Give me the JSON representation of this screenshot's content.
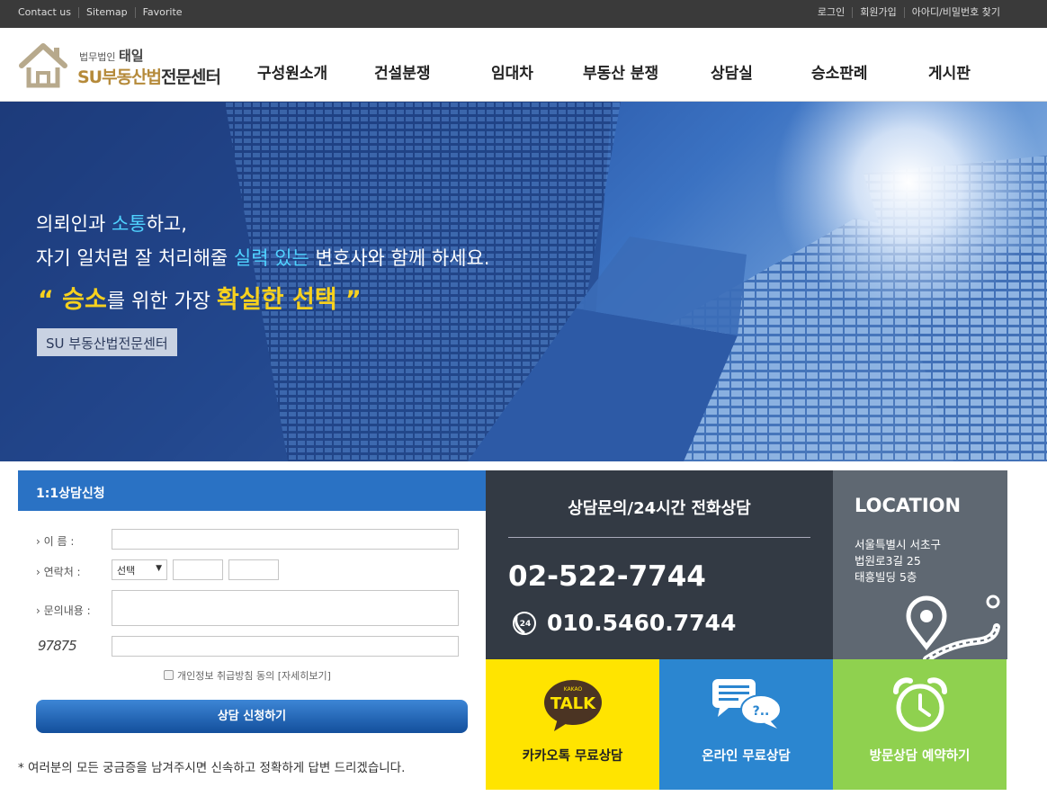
{
  "topbar": {
    "left_links": [
      "Contact us",
      "Sitemap",
      "Favorite"
    ],
    "right_links": [
      "로그인",
      "회원가입",
      "아아디/비밀번호 찾기"
    ]
  },
  "logo": {
    "small_prefix": "법무법인",
    "small_name": "태일",
    "brand_colored": "SU부동산법",
    "brand_dark": "전문센터"
  },
  "nav": [
    "구성원소개",
    "건설분쟁",
    "임대차",
    "부동산 분쟁",
    "상담실",
    "승소판례",
    "게시판"
  ],
  "hero": {
    "line1_a": "의뢰인과 ",
    "line1_hl": "소통",
    "line1_b": "하고,",
    "line2_a": "자기 일처럼 잘 처리해줄 ",
    "line2_hl": "실력 있는",
    "line2_b": " 변호사와 함께 하세요.",
    "line3_q1": "“ ",
    "line3_gold1": "승소",
    "line3_mid": "를 위한 가장 ",
    "line3_gold2": "확실한 선택",
    "line3_q2": " ”",
    "badge": "SU 부동산법전문센터"
  },
  "form": {
    "title": "1:1상담신청",
    "name_label": "이 름 :",
    "contact_label": "연락처 :",
    "contact_select": "선택",
    "inquiry_label": "문의내용 :",
    "captcha": "97875",
    "agree_text": "개인정보 취급방침 동의",
    "agree_link": "[자세히보기]",
    "submit": "상담 신청하기",
    "note": "* 여러분의 모든 궁금증을 남겨주시면 신속하고 정확하게 답변 드리겠습니다."
  },
  "phone": {
    "title": "상담문의/24시간 전화상담",
    "number1": "02-522-7744",
    "number2": "010.5460.7744",
    "icon": "phone-24-icon"
  },
  "location": {
    "title": "LOCATION",
    "address": [
      "서울특별시 서초구",
      "법원로3길 25",
      "태흥빌딩 5층"
    ],
    "icon": "map-pin-icon"
  },
  "tiles": [
    {
      "label": "카카오톡 무료상담",
      "icon": "kakao-talk-icon",
      "kakao_small": "KAKAO",
      "kakao_talk": "TALK",
      "color": "#ffe400"
    },
    {
      "label": "온라인 무료상담",
      "icon": "chat-bubbles-icon",
      "color": "#2b86d0"
    },
    {
      "label": "방문상담 예약하기",
      "icon": "alarm-clock-icon",
      "color": "#8fd14f"
    }
  ]
}
